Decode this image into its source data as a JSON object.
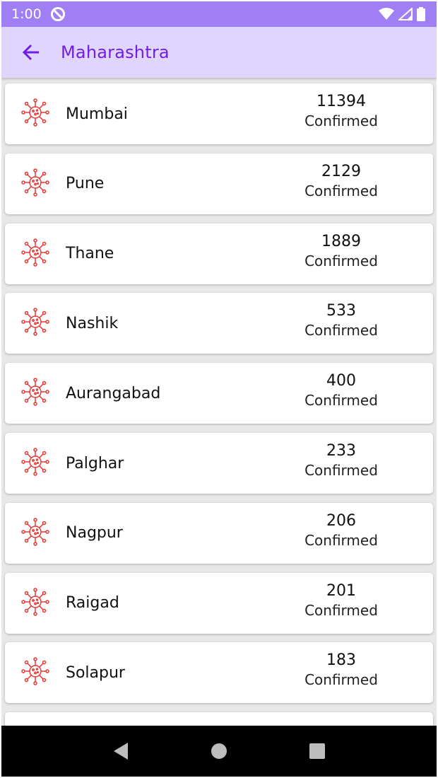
{
  "status_bar": {
    "time": "1:00"
  },
  "app_bar": {
    "title": "Maharashtra",
    "accent_color": "#6f1ee8",
    "background_color": "#e0d6fd"
  },
  "districts": [
    {
      "name": "Mumbai",
      "count": "11394",
      "label": "Confirmed"
    },
    {
      "name": "Pune",
      "count": "2129",
      "label": "Confirmed"
    },
    {
      "name": "Thane",
      "count": "1889",
      "label": "Confirmed"
    },
    {
      "name": "Nashik",
      "count": "533",
      "label": "Confirmed"
    },
    {
      "name": "Aurangabad",
      "count": "400",
      "label": "Confirmed"
    },
    {
      "name": "Palghar",
      "count": "233",
      "label": "Confirmed"
    },
    {
      "name": "Nagpur",
      "count": "206",
      "label": "Confirmed"
    },
    {
      "name": "Raigad",
      "count": "201",
      "label": "Confirmed"
    },
    {
      "name": "Solapur",
      "count": "183",
      "label": "Confirmed"
    },
    {
      "name": "",
      "count": "",
      "label": ""
    }
  ],
  "icons": {
    "district": "virus-icon",
    "back": "arrow-left-icon"
  },
  "nav_bar": {
    "back": "triangle-back-icon",
    "home": "circle-home-icon",
    "recents": "square-recents-icon"
  }
}
